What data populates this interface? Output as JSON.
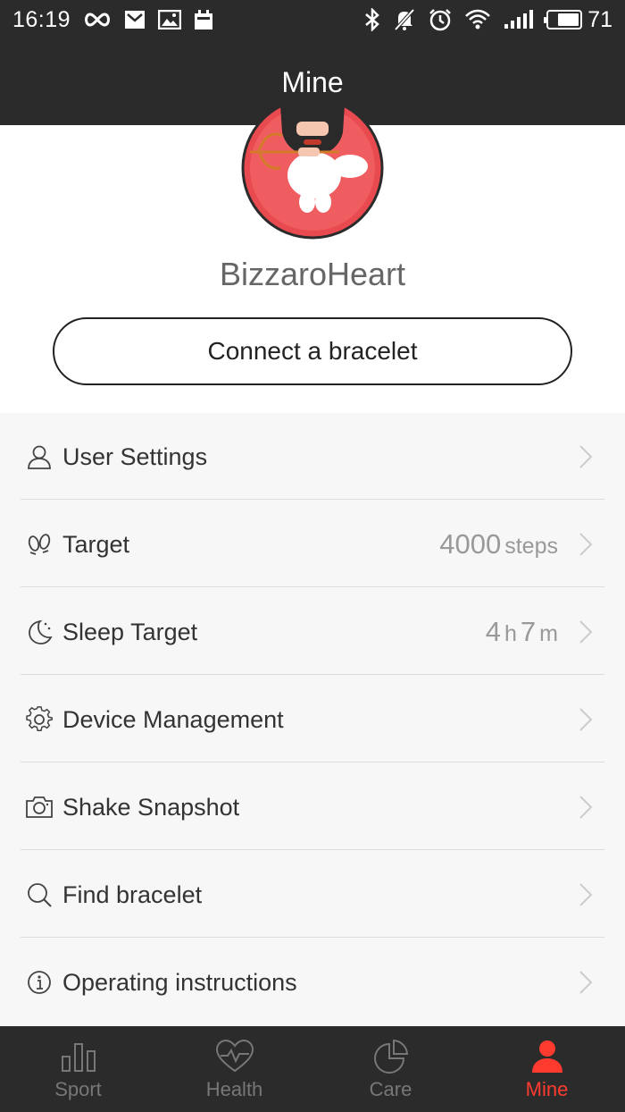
{
  "status_bar": {
    "time": "16:19",
    "battery": "71",
    "left_icons": [
      "infinity-icon",
      "mail-icon",
      "image-icon",
      "calendar-icon"
    ],
    "right_icons": [
      "bluetooth-icon",
      "mute-icon",
      "alarm-icon",
      "wifi-icon",
      "signal-icon",
      "battery-icon"
    ]
  },
  "header": {
    "title": "Mine"
  },
  "profile": {
    "username": "BizzaroHeart",
    "connect_label": "Connect a bracelet",
    "avatar_icon": "cupid-avatar"
  },
  "menu": {
    "items": [
      {
        "label": "User Settings",
        "icon": "user-icon",
        "value_num": "",
        "value_unit": ""
      },
      {
        "label": "Target",
        "icon": "footprints-icon",
        "value_num": "4000",
        "value_unit": "steps"
      },
      {
        "label": "Sleep Target",
        "icon": "moon-icon",
        "value_num": "",
        "value_unit": ""
      },
      {
        "label": "Device Management",
        "icon": "gear-icon",
        "value_num": "",
        "value_unit": ""
      },
      {
        "label": "Shake Snapshot",
        "icon": "camera-icon",
        "value_num": "",
        "value_unit": ""
      },
      {
        "label": "Find bracelet",
        "icon": "search-icon",
        "value_num": "",
        "value_unit": ""
      },
      {
        "label": "Operating instructions",
        "icon": "info-icon",
        "value_num": "",
        "value_unit": ""
      }
    ],
    "sleep": {
      "h_num": "4",
      "h_unit": "h",
      "m_num": "7",
      "m_unit": "m"
    }
  },
  "bottom_nav": {
    "items": [
      {
        "label": "Sport",
        "icon": "bar-chart-icon",
        "active": false
      },
      {
        "label": "Health",
        "icon": "heart-pulse-icon",
        "active": false
      },
      {
        "label": "Care",
        "icon": "pie-chart-icon",
        "active": false
      },
      {
        "label": "Mine",
        "icon": "person-icon",
        "active": true
      }
    ]
  },
  "colors": {
    "bar_bg": "#2b2b2b",
    "active": "#ff3b30",
    "inactive": "#777777",
    "list_bg": "#f7f7f7"
  }
}
